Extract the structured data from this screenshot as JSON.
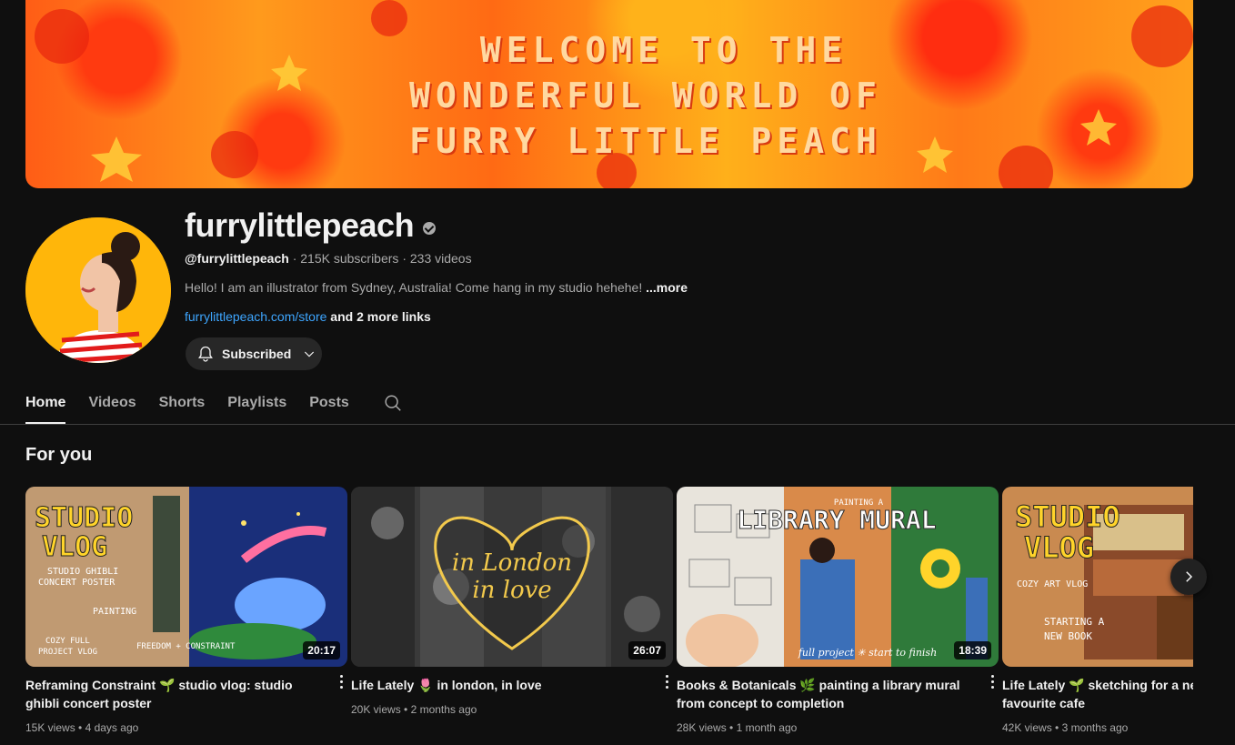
{
  "banner": {
    "line1": "WELCOME TO THE",
    "line2": "WONDERFUL WORLD OF",
    "line3": "FURRY LITTLE PEACH"
  },
  "channel": {
    "name": "furrylittlepeach",
    "handle": "@furrylittlepeach",
    "subscribers": "215K subscribers",
    "videos": "233 videos",
    "description": "Hello! I am an illustrator from Sydney, Australia! Come hang in my studio hehehe!",
    "more_label": "...more",
    "link": "furrylittlepeach.com/store",
    "more_links": "and 2 more links",
    "subscribe_label": "Subscribed"
  },
  "tabs": [
    {
      "label": "Home",
      "active": true
    },
    {
      "label": "Videos"
    },
    {
      "label": "Shorts"
    },
    {
      "label": "Playlists"
    },
    {
      "label": "Posts"
    }
  ],
  "section": {
    "title": "For you"
  },
  "videos": [
    {
      "title": "Reframing Constraint 🌱 studio vlog: studio ghibli concert poster",
      "views": "15K views",
      "age": "4 days ago",
      "duration": "20:17",
      "thumb_text": [
        "STUDIO",
        "VLOG",
        "STUDIO GHIBLI",
        "CONCERT POSTER",
        "PAINTING",
        "COZY FULL",
        "PROJECT VLOG",
        "FREEDOM + CONSTRAINT"
      ]
    },
    {
      "title": "Life Lately 🌷 in london, in love",
      "views": "20K views",
      "age": "2 months ago",
      "duration": "26:07",
      "thumb_text": [
        "in London",
        "in love"
      ]
    },
    {
      "title": "Books & Botanicals 🌿 painting a library mural from concept to completion",
      "views": "28K views",
      "age": "1 month ago",
      "duration": "18:39",
      "thumb_text": [
        "PAINTING A",
        "LIBRARY MURAL",
        "full project ✳ start to finish"
      ]
    },
    {
      "title": "Life Lately 🌱 sketching for a new book at my favourite cafe",
      "views": "42K views",
      "age": "3 months ago",
      "duration": "",
      "thumb_text": [
        "STUDIO",
        "VLOG",
        "COZY ART VLOG",
        "STARTING A",
        "NEW BOOK"
      ]
    }
  ],
  "icons": {
    "bell": "bell-icon",
    "chevron": "chevron-down-icon",
    "search": "search-icon",
    "next": "chevron-right-icon",
    "verified": "verified-icon",
    "more": "more-vert-icon"
  },
  "colors": {
    "background": "#0f0f0f",
    "link": "#3ea6ff",
    "text": "#f1f1f1",
    "secondary": "#aaaaaa"
  }
}
